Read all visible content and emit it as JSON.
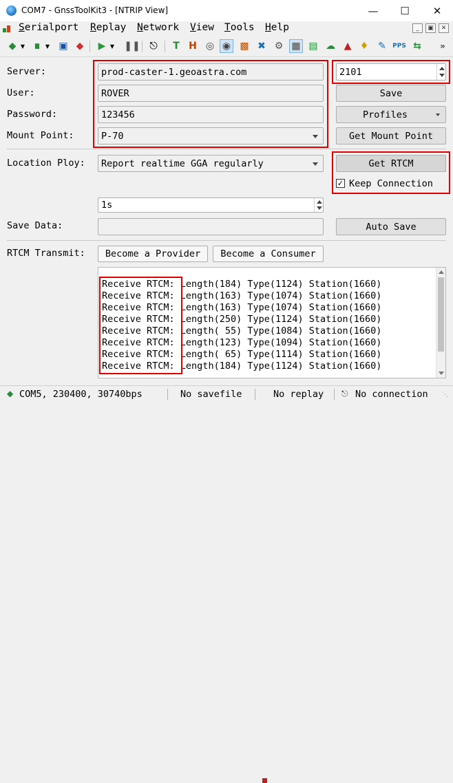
{
  "window": {
    "title": "COM7 - GnssToolKit3 - [NTRIP View]",
    "minimize": "—",
    "maximize": "☐",
    "close": "✕"
  },
  "menu": {
    "items": [
      "Serialport",
      "Replay",
      "Network",
      "View",
      "Tools",
      "Help"
    ]
  },
  "toolbar": {
    "icons": [
      "serial-connect-icon",
      "dropdown-icon",
      "signal-icon",
      "dropdown-icon",
      "save-icon",
      "tag-icon",
      "play-icon",
      "dropdown-icon",
      "pause-icon",
      "plug-icon",
      "text-icon",
      "hex-icon",
      "target-icon",
      "ntrip-icon",
      "chart-icon",
      "satellite-icon",
      "gear-icon",
      "grid-icon",
      "table-icon",
      "cloud-icon",
      "compass-icon",
      "bell-icon",
      "pen-icon",
      "pps-icon",
      "swap-icon",
      "more-icon"
    ]
  },
  "form": {
    "server_label": "Server:",
    "server_value": "prod-caster-1.geoastra.com",
    "port_value": "2101",
    "user_label": "User:",
    "user_value": "ROVER",
    "save_button": "Save",
    "password_label": "Password:",
    "password_value": "123456",
    "profiles_button": "Profiles",
    "mount_label": "Mount Point:",
    "mount_value": "P-70",
    "get_mount_button": "Get Mount Point",
    "location_label": "Location Ploy:",
    "location_value": "Report realtime GGA regularly",
    "get_rtcm_button": "Get RTCM",
    "keep_connection_label": "Keep Connection",
    "keep_connection_checked": true,
    "interval_value": "1s",
    "save_data_label": "Save Data:",
    "save_data_value": "",
    "auto_save_button": "Auto Save",
    "rtcm_transmit_label": "RTCM Transmit:",
    "provider_button": "Become a Provider",
    "consumer_button": "Become a Consumer"
  },
  "log": {
    "prefix": "Receive RTCM:",
    "lines": [
      " Length(184) Type(1124) Station(1660)",
      " Length(163) Type(1074) Station(1660)",
      " Length(163) Type(1074) Station(1660)",
      " Length(250) Type(1124) Station(1660)",
      " Length( 55) Type(1084) Station(1660)",
      " Length(123) Type(1094) Station(1660)",
      " Length( 65) Type(1114) Station(1660)",
      " Length(184) Type(1124) Station(1660)"
    ]
  },
  "status": {
    "port": "COM5, 230400, 30740bps",
    "savefile": "No savefile",
    "replay": "No replay",
    "connection": "No connection"
  },
  "colors": {
    "highlight_box": "#e00000",
    "title_bar": "#ffffff",
    "window_bg": "#f0f0f0"
  }
}
